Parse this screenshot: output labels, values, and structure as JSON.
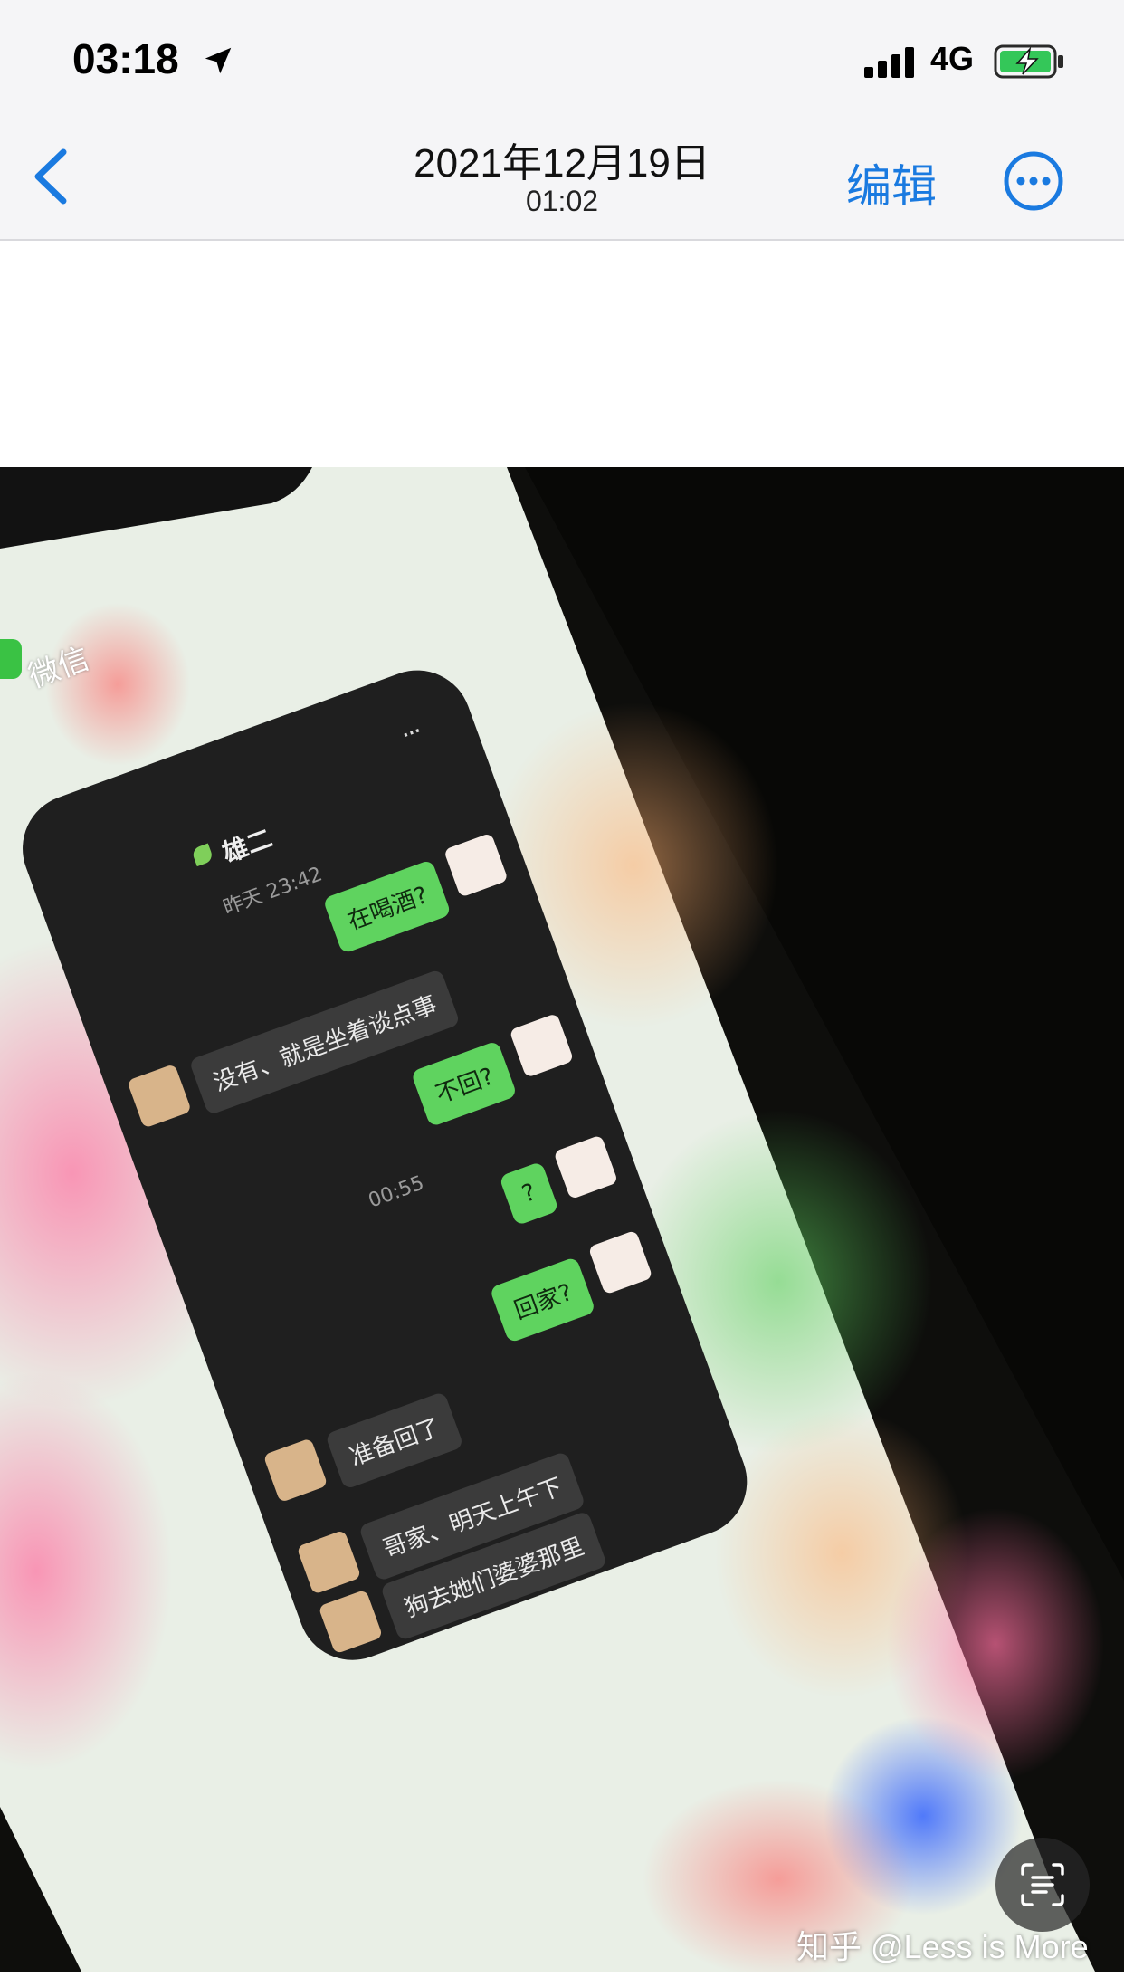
{
  "status_bar": {
    "time": "03:18",
    "network": "4G",
    "location_icon": "location-arrow-icon",
    "signal_icon": "signal-bars-icon",
    "battery_icon": "battery-charging-icon"
  },
  "nav": {
    "title": "2021年12月19日",
    "subtitle": "01:02",
    "edit_label": "编辑",
    "back_icon": "chevron-left-icon",
    "more_icon": "ellipsis-circle-icon"
  },
  "photo": {
    "app_label": "微信",
    "chat_title": "雄二",
    "menu_glyph": "···",
    "timestamps": [
      "昨天 23:42",
      "00:55"
    ],
    "messages": [
      {
        "side": "me",
        "text": "在喝酒?"
      },
      {
        "side": "them",
        "text": "没有、就是坐着谈点事"
      },
      {
        "side": "me",
        "text": "不回?"
      },
      {
        "side": "me",
        "text": "?"
      },
      {
        "side": "me",
        "text": "回家?"
      },
      {
        "side": "them",
        "text": "准备回了"
      },
      {
        "side": "them",
        "text": "哥家、明天上午下"
      },
      {
        "side": "them",
        "text": "狗去她们婆婆那里"
      }
    ]
  },
  "live_text_icon": "live-text-icon",
  "watermark": "知乎 @Less is More",
  "colors": {
    "accent": "#1a7ae0",
    "bubble_me": "#5fd35f",
    "bubble_them": "#3b3b3b",
    "chat_bg": "#1f1f1f"
  }
}
